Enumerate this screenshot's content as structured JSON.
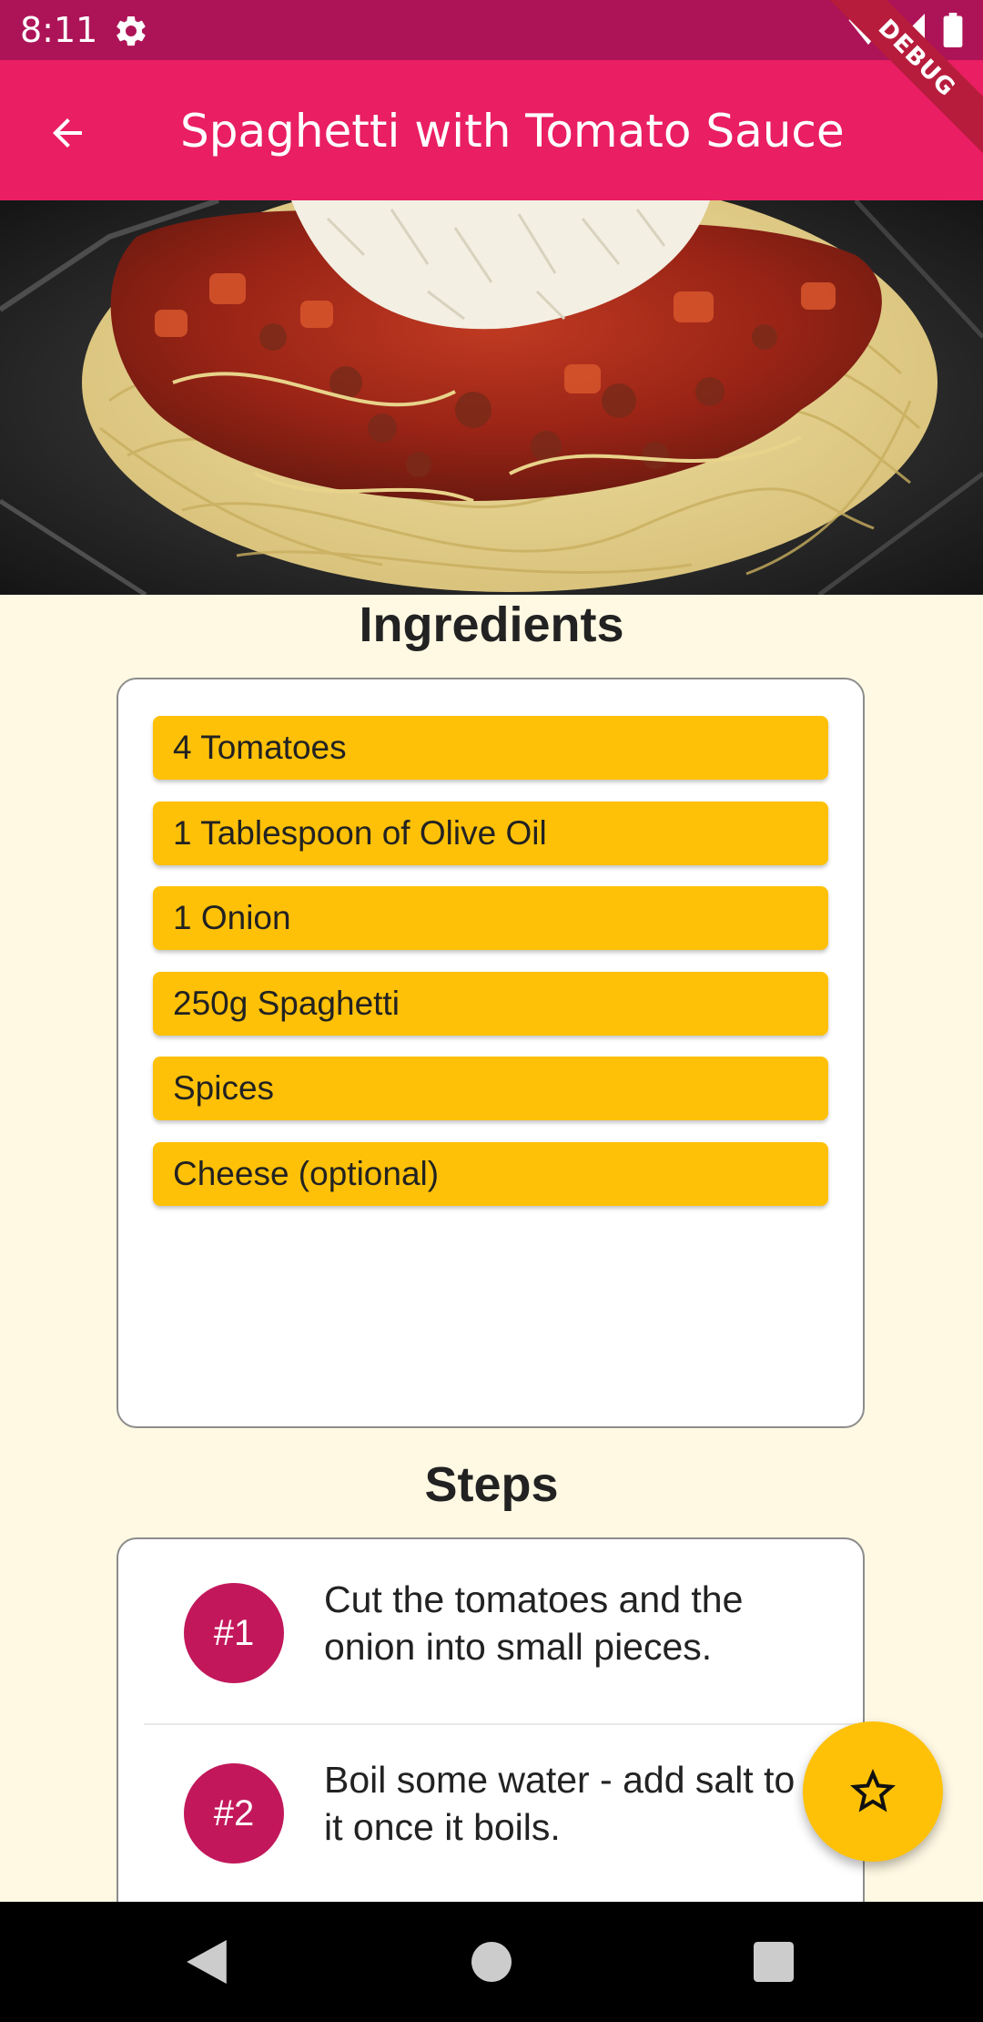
{
  "status_bar": {
    "time": "8:11",
    "icons": [
      "settings-gear-icon",
      "wifi-icon",
      "signal-icon",
      "battery-icon"
    ]
  },
  "app_bar": {
    "title": "Spaghetti with Tomato Sauce",
    "back_icon": "arrow-back-icon",
    "color": "#e91e63"
  },
  "debug_banner": "DEBUG",
  "hero_image": {
    "depicts": "spaghetti-with-tomato-sauce-photo"
  },
  "ingredients": {
    "title": "Ingredients",
    "items": [
      "4 Tomatoes",
      "1 Tablespoon of Olive Oil",
      "1 Onion",
      "250g Spaghetti",
      "Spices",
      "Cheese (optional)"
    ],
    "item_color": "#ffc107"
  },
  "steps": {
    "title": "Steps",
    "items": [
      {
        "badge": "#1",
        "text": "Cut the tomatoes and the onion into small pieces."
      },
      {
        "badge": "#2",
        "text": "Boil some water - add salt to it once it boils."
      }
    ],
    "badge_color": "#c2185b"
  },
  "fab": {
    "icon": "star-outline-icon",
    "color": "#ffc107"
  },
  "nav_bar": {
    "icons": [
      "nav-back-icon",
      "nav-home-icon",
      "nav-recents-icon"
    ]
  }
}
